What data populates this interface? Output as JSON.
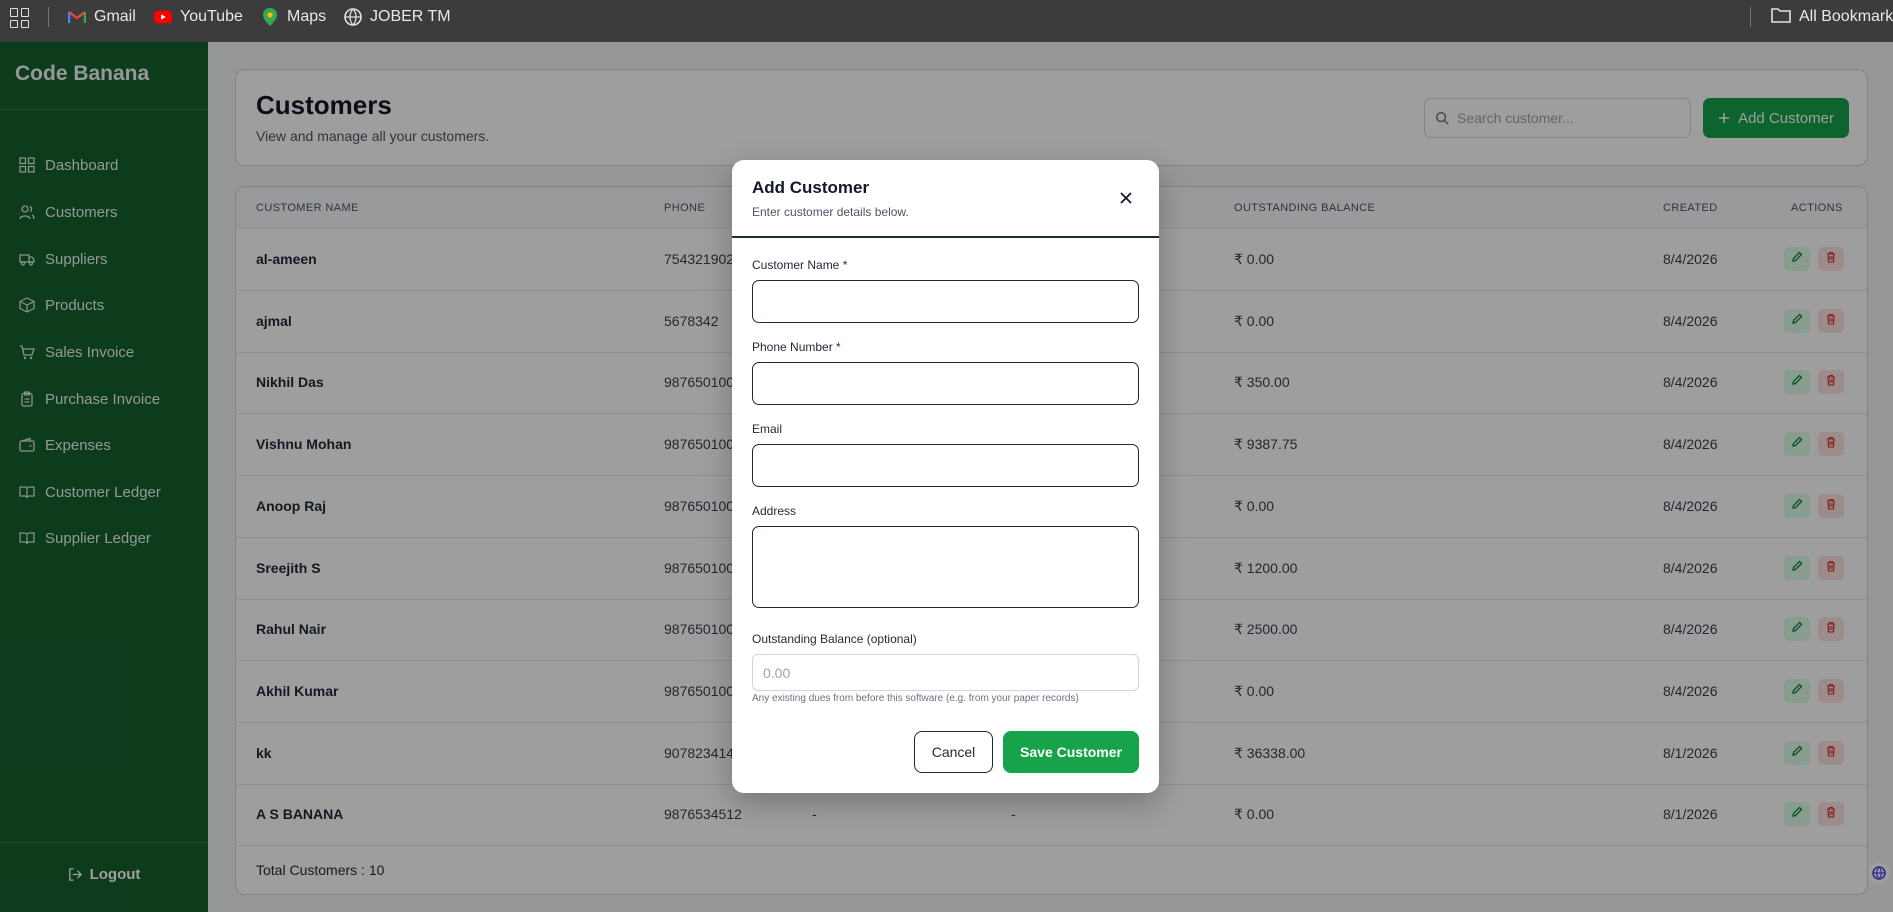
{
  "bookmarks": {
    "items": [
      {
        "label": "Gmail",
        "icon": "gmail-icon"
      },
      {
        "label": "YouTube",
        "icon": "youtube-icon"
      },
      {
        "label": "Maps",
        "icon": "maps-icon"
      },
      {
        "label": "JOBER TM",
        "icon": "globe-icon"
      }
    ],
    "all_label": "All Bookmarks"
  },
  "sidebar": {
    "brand": "Code Banana",
    "items": [
      {
        "label": "Dashboard",
        "icon": "grid-icon"
      },
      {
        "label": "Customers",
        "icon": "users-icon"
      },
      {
        "label": "Suppliers",
        "icon": "truck-icon"
      },
      {
        "label": "Products",
        "icon": "package-icon"
      },
      {
        "label": "Sales Invoice",
        "icon": "cart-icon"
      },
      {
        "label": "Purchase Invoice",
        "icon": "clipboard-icon"
      },
      {
        "label": "Expenses",
        "icon": "wallet-icon"
      },
      {
        "label": "Customer Ledger",
        "icon": "book-icon"
      },
      {
        "label": "Supplier Ledger",
        "icon": "book-icon"
      }
    ],
    "logout": "Logout"
  },
  "header": {
    "title": "Customers",
    "subtitle": "View and manage all your customers.",
    "search_placeholder": "Search customer...",
    "add_label": "Add Customer"
  },
  "table": {
    "columns": {
      "name": "CUSTOMER NAME",
      "phone": "PHONE",
      "balance": "OUTSTANDING BALANCE",
      "created": "CREATED",
      "actions": "ACTIONS"
    },
    "rows": [
      {
        "name": "al-ameen",
        "phone": "754321902",
        "email": "",
        "address": "",
        "balance": "₹ 0.00",
        "created": "8/4/2026"
      },
      {
        "name": "ajmal",
        "phone": "5678342",
        "email": "",
        "address": "",
        "balance": "₹ 0.00",
        "created": "8/4/2026"
      },
      {
        "name": "Nikhil Das",
        "phone": "987650100",
        "email": "",
        "address": "",
        "balance": "₹ 350.00",
        "created": "8/4/2026"
      },
      {
        "name": "Vishnu Mohan",
        "phone": "987650100",
        "email": "",
        "address": "",
        "balance": "₹ 9387.75",
        "created": "8/4/2026"
      },
      {
        "name": "Anoop Raj",
        "phone": "987650100",
        "email": "",
        "address": "",
        "balance": "₹ 0.00",
        "created": "8/4/2026"
      },
      {
        "name": "Sreejith S",
        "phone": "987650100",
        "email": "",
        "address": "",
        "balance": "₹ 1200.00",
        "created": "8/4/2026"
      },
      {
        "name": "Rahul Nair",
        "phone": "987650100",
        "email": "",
        "address": "",
        "balance": "₹ 2500.00",
        "created": "8/4/2026"
      },
      {
        "name": "Akhil Kumar",
        "phone": "987650100",
        "email": "",
        "address": "",
        "balance": "₹ 0.00",
        "created": "8/4/2026"
      },
      {
        "name": "kk",
        "phone": "907823414",
        "email": "",
        "address": "",
        "balance": "₹ 36338.00",
        "created": "8/1/2026"
      },
      {
        "name": "A S BANANA",
        "phone": "9876534512",
        "email": "-",
        "address": "-",
        "balance": "₹ 0.00",
        "created": "8/1/2026"
      }
    ],
    "footer": "Total Customers : 10"
  },
  "modal": {
    "title": "Add Customer",
    "subtitle": "Enter customer details below.",
    "name_label": "Customer Name *",
    "phone_label": "Phone Number *",
    "email_label": "Email",
    "address_label": "Address",
    "balance_label": "Outstanding Balance (optional)",
    "balance_placeholder": "0.00",
    "hint": "Any existing dues from before this software (e.g. from your paper records)",
    "cancel_label": "Cancel",
    "save_label": "Save Customer"
  },
  "colors": {
    "sidebar": "#14612e",
    "accent": "#16a34a",
    "edit_bg": "#dcfce7",
    "delete_bg": "#fee2e2"
  }
}
